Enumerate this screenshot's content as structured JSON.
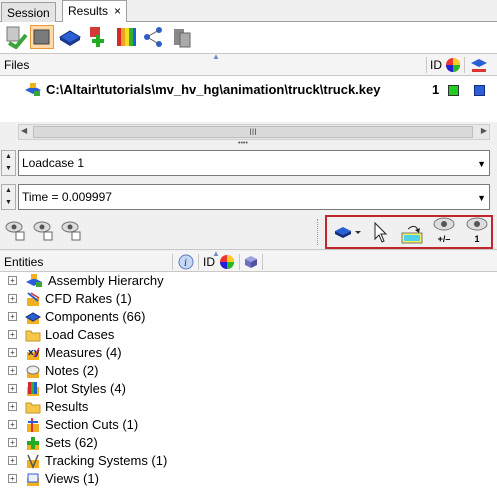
{
  "tabs": [
    {
      "label": "Session"
    },
    {
      "label": "Results",
      "close": "×"
    }
  ],
  "toolbar": {
    "icons": [
      "load-results-icon",
      "open-folder-icon",
      "component-icon",
      "add-icon",
      "contour-icon",
      "network-icon",
      "cylinder-icon"
    ]
  },
  "files": {
    "header": "Files",
    "col_id": "ID",
    "rows": [
      {
        "path": "C:\\Altair\\tutorials\\mv_hv_hg\\animation\\truck\\truck.key",
        "id": "1",
        "color": "#22cc22"
      }
    ]
  },
  "scroll": {
    "grip": "III",
    "splitter": "••••"
  },
  "loadcase": {
    "value": "Loadcase 1"
  },
  "time": {
    "value": "Time = 0.009997"
  },
  "maskbar": {
    "show_all_label": "+/–",
    "isolate_label": "1"
  },
  "entities": {
    "header": "Entities",
    "col_id": "ID",
    "items": [
      {
        "label": "Assembly Hierarchy",
        "icon": "assembly-icon"
      },
      {
        "label": "CFD Rakes (1)",
        "icon": "cfd-rake-icon"
      },
      {
        "label": "Components (66)",
        "icon": "component-icon"
      },
      {
        "label": "Load Cases",
        "icon": "folder-icon"
      },
      {
        "label": "Measures (4)",
        "icon": "measure-icon"
      },
      {
        "label": "Notes (2)",
        "icon": "note-icon"
      },
      {
        "label": "Plot Styles (4)",
        "icon": "plot-style-icon"
      },
      {
        "label": "Results",
        "icon": "folder-icon"
      },
      {
        "label": "Section Cuts (1)",
        "icon": "section-cut-icon"
      },
      {
        "label": "Sets  (62)",
        "icon": "set-icon"
      },
      {
        "label": "Tracking Systems (1)",
        "icon": "tracking-system-icon"
      },
      {
        "label": "Views (1)",
        "icon": "view-icon"
      }
    ]
  }
}
